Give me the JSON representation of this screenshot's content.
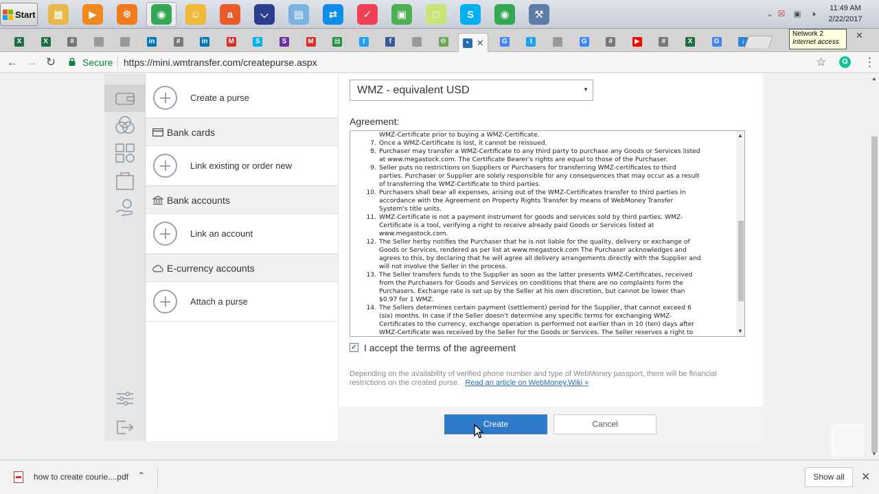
{
  "taskbar": {
    "start_label": "Start",
    "apps": [
      {
        "icon": "file-manager-icon",
        "color": "#e8b84a"
      },
      {
        "icon": "media-player-icon",
        "color": "#f08a1c"
      },
      {
        "icon": "browser-uc-icon",
        "color": "#f27a1a"
      },
      {
        "icon": "chrome-icon",
        "color": "#34a853"
      },
      {
        "icon": "paint-icon",
        "color": "#f0b93a"
      },
      {
        "icon": "avast-icon",
        "color": "#e85a2a"
      },
      {
        "icon": "headphones-icon",
        "color": "#2b3d8c"
      },
      {
        "icon": "notepad-icon",
        "color": "#7ab3e0"
      },
      {
        "icon": "teamviewer-icon",
        "color": "#0e8ee9"
      },
      {
        "icon": "pocket-icon",
        "color": "#ef4056"
      },
      {
        "icon": "bluestacks-icon",
        "color": "#4caf50"
      },
      {
        "icon": "sticky-notes-icon",
        "color": "#c7e57a"
      },
      {
        "icon": "skype-icon",
        "color": "#00aff0"
      },
      {
        "icon": "chrome-icon",
        "color": "#34a853"
      },
      {
        "icon": "tools-icon",
        "color": "#5b7da8"
      }
    ],
    "clock_time": "11:49 AM",
    "clock_date": "2/22/2017"
  },
  "tabs": [
    {
      "icon": "excel-icon",
      "color": "#1d6f42",
      "glyph": "X"
    },
    {
      "icon": "excel-icon",
      "color": "#1d6f42",
      "glyph": "X"
    },
    {
      "icon": "globe-icon",
      "color": "#777777",
      "glyph": "#"
    },
    {
      "icon": "document-icon",
      "color": "#999999",
      "glyph": ""
    },
    {
      "icon": "document-icon",
      "color": "#999999",
      "glyph": ""
    },
    {
      "icon": "linkedin-icon",
      "color": "#0077b5",
      "glyph": "in"
    },
    {
      "icon": "globe-icon",
      "color": "#777777",
      "glyph": "#"
    },
    {
      "icon": "linkedin-icon",
      "color": "#0077b5",
      "glyph": "in"
    },
    {
      "icon": "gmail-icon",
      "color": "#d93025",
      "glyph": "M"
    },
    {
      "icon": "skype-icon",
      "color": "#00aff0",
      "glyph": "S"
    },
    {
      "icon": "skype-icon",
      "color": "#6b2fa0",
      "glyph": "S"
    },
    {
      "icon": "gmail-icon",
      "color": "#d93025",
      "glyph": "M"
    },
    {
      "icon": "sheets-icon",
      "color": "#1e8e3e",
      "glyph": "▤"
    },
    {
      "icon": "twitter-icon",
      "color": "#1da1f2",
      "glyph": "t"
    },
    {
      "icon": "facebook-icon",
      "color": "#3b5998",
      "glyph": "f"
    },
    {
      "icon": "document-icon",
      "color": "#999999",
      "glyph": ""
    },
    {
      "icon": "extension-icon",
      "color": "#6aa84f",
      "glyph": "⚙"
    },
    {
      "icon": "wm-tab-icon",
      "color": "#2a6eb0",
      "glyph": "•"
    },
    {
      "icon": "google-icon",
      "color": "#4285f4",
      "glyph": "G"
    },
    {
      "icon": "twitter-icon",
      "color": "#1da1f2",
      "glyph": "t"
    },
    {
      "icon": "document-icon",
      "color": "#999999",
      "glyph": ""
    },
    {
      "icon": "google-icon",
      "color": "#4285f4",
      "glyph": "G"
    },
    {
      "icon": "globe-icon",
      "color": "#777777",
      "glyph": "#"
    },
    {
      "icon": "youtube-icon",
      "color": "#ff0000",
      "glyph": "▶"
    },
    {
      "icon": "globe-icon",
      "color": "#777777",
      "glyph": "#"
    },
    {
      "icon": "excel-icon",
      "color": "#1d6f42",
      "glyph": "X"
    },
    {
      "icon": "google-icon",
      "color": "#4285f4",
      "glyph": "G"
    },
    {
      "icon": "download-icon",
      "color": "#2a86d9",
      "glyph": "↓"
    }
  ],
  "tooltip": {
    "line1": "Network  2",
    "line2": "Internet access"
  },
  "address": {
    "secure_label": "Secure",
    "url": "https://mini.wmtransfer.com/createpurse.aspx"
  },
  "left_panel": {
    "create_purse": "Create a purse",
    "bank_cards": "Bank cards",
    "link_existing": "Link existing or order new",
    "bank_accounts": "Bank accounts",
    "link_account": "Link an account",
    "ecurrency": "E-currency accounts",
    "attach_purse": "Attach a purse"
  },
  "form": {
    "currency_value": "WMZ - equivalent USD",
    "agreement_label": "Agreement:",
    "agreement_lines": [
      {
        "num": "",
        "text": "WMZ-Certificate prior to buying a WMZ-Certificate."
      },
      {
        "num": "7.",
        "text": "Once a WMZ-Certificate is lost, it cannot be reissued."
      },
      {
        "num": "8.",
        "text": "Purchaser may transfer a WMZ-Certificate to any third party to purchase any Goods or Services listed"
      },
      {
        "num": "",
        "text": "at www.megastock.com. The Certificate Bearer's rights are equal to those of the Purchaser."
      },
      {
        "num": "9.",
        "text": "Seller puts no restrictions on Suppliers or Purchasers for transferring WMZ-certificates to third"
      },
      {
        "num": "",
        "text": "parties. Purchaser or Supplier are solely responsible for any consequences that may occur as a result"
      },
      {
        "num": "",
        "text": "of transferring the WMZ-Certificate to third parties."
      },
      {
        "num": "10.",
        "text": "Purchasers shall bear all expenses, arising out of the WMZ-Certificates transfer to third parties in"
      },
      {
        "num": "",
        "text": "accordance with the Agreement on Property Rights Transfer by means of WebMoney Transfer"
      },
      {
        "num": "",
        "text": "System's title units."
      },
      {
        "num": "11.",
        "text": "WMZ-Certificate is not a payment instrument for goods and services sold by third parties. WMZ-"
      },
      {
        "num": "",
        "text": "Certificate is a tool, verifying a right to receive already paid Goods or Services listed at"
      },
      {
        "num": "",
        "text": "www.megastock.com."
      },
      {
        "num": "12.",
        "text": "The Seller herby notifies the Purchaser that he is not liable for the quality, delivery or exchange of"
      },
      {
        "num": "",
        "text": "Goods or Services, rendered as per list at www.megastock.com The Purchaser acknowledges and"
      },
      {
        "num": "",
        "text": "agrees to this, by declaring that he will agree all delivery arrangements directly with the Supplier and"
      },
      {
        "num": "",
        "text": "will not involve the Seller in the process."
      },
      {
        "num": "13.",
        "text": "The Seller transfers funds to the Supplier as soon as the latter presents WMZ-Certificates, received"
      },
      {
        "num": "",
        "text": "from the Purchasers for Goods and Services on conditions that there are no complaints form the"
      },
      {
        "num": "",
        "text": "Purchasers. Exchange rate is set up by the Seller at his own discretion, but cannot be lower than"
      },
      {
        "num": "",
        "text": "$0.97 for 1 WMZ."
      },
      {
        "num": "14.",
        "text": "The Sellers determines certain payment (settlement) period for the Supplier, that cannot exceed 6"
      },
      {
        "num": "",
        "text": "(six) months. In case if the Seller doesn't determine any specific terms for exchanging WMZ-"
      },
      {
        "num": "",
        "text": "Certificates to the currency, exchange operation is performed not earlier than in 10 (ten) days after"
      },
      {
        "num": "",
        "text": "WMZ-Certificate was received by the Seller for the Goods or Services. The Seller reserves a right to"
      }
    ],
    "accept_label": "I accept the terms of the agreement",
    "accept_checked": true,
    "restrictions_note": "Depending on the availability of verified phone number and type of WebMoney passport, there will be financial restrictions on the created purse.",
    "wiki_link": "Read an article on WebMoney.Wiki »",
    "create_label": "Create",
    "cancel_label": "Cancel"
  },
  "downloads": {
    "file_name": "how to create courie....pdf",
    "show_all": "Show all"
  },
  "colors": {
    "primary_button": "#2f7bc9",
    "link": "#2a6eb0",
    "secure_green": "#0b8043"
  }
}
